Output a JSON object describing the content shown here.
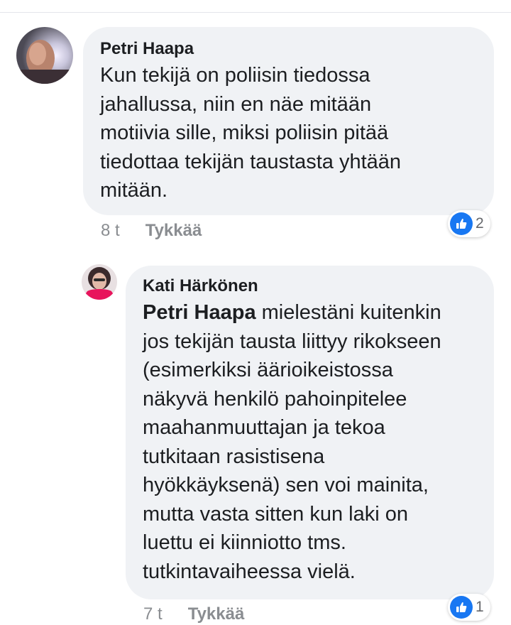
{
  "comments": [
    {
      "author": "Petri Haapa",
      "text": "Kun  tekijä on poliisin tiedossa\njahallussa, niin en näe mitään\nmotiivia sille, miksi poliisin pitää\ntiedottaa tekijän taustasta yhtään\nmitään.",
      "time": "8 t",
      "like_label": "Tykkää",
      "reaction_count": "2",
      "reaction_icon": "thumbs-up-icon"
    },
    {
      "author": "Kati Härkönen",
      "mention": "Petri Haapa",
      "text": " mielestäni kuitenkin\njos tekijän tausta liittyy rikokseen\n(esimerkiksi äärioikeistossa\nnäkyvä henkilö pahoinpitelee\nmaahanmuuttajan ja tekoa\ntutkitaan rasistisena\nhyökkäyksenä) sen voi mainita,\nmutta vasta sitten kun laki on\nluettu ei kiinniotto tms.\ntutkintavaiheessa vielä.",
      "time": "7 t",
      "like_label": "Tykkää",
      "reaction_count": "1",
      "reaction_icon": "thumbs-up-icon"
    }
  ],
  "colors": {
    "bubble_bg": "#f0f2f5",
    "meta_text": "#8a8d91",
    "like_blue": "#1877f2"
  }
}
